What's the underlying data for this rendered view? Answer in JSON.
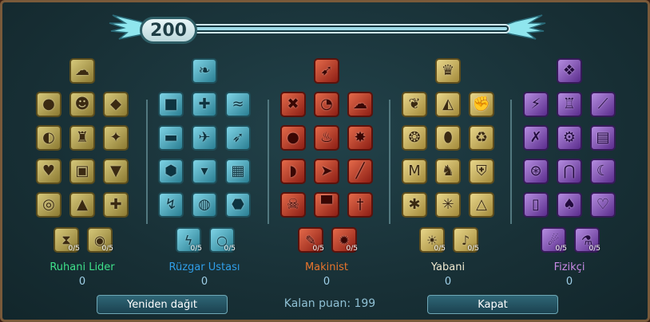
{
  "level": {
    "value": "200",
    "progress": 1.0
  },
  "trees": [
    {
      "name": "Ruhani Lider",
      "points": "0",
      "color": "#3ee08a",
      "theme": "t-green",
      "top_icon": "spirit-icon",
      "grid": [
        "apple-icon",
        "mask-icon",
        "shield-icon",
        "shell-icon",
        "totem-icon",
        "rune-icon",
        "heart-icon",
        "chest-icon",
        "vest-icon",
        "ring-icon",
        "spikes-icon",
        "heart-plus-icon"
      ],
      "perks": [
        {
          "icon": "hourglass-icon",
          "count": "0/5"
        },
        {
          "icon": "orb-icon",
          "count": "0/5"
        }
      ]
    },
    {
      "name": "Rüzgar Ustası",
      "points": "0",
      "color": "#2f9ee8",
      "theme": "t-blue",
      "top_icon": "feather-icon",
      "grid": [
        "box-icon",
        "medic-icon",
        "wave-icon",
        "log-icon",
        "eagle-icon",
        "bow-icon",
        "rock-icon",
        "drop-icon",
        "crate-icon",
        "hook-icon",
        "globe-icon",
        "nut-icon"
      ],
      "perks": [
        {
          "icon": "lightning-icon",
          "count": "0/5"
        },
        {
          "icon": "bubble-icon",
          "count": "0/5"
        }
      ]
    },
    {
      "name": "Makinist",
      "points": "0",
      "color": "#e8742c",
      "theme": "t-red",
      "top_icon": "rocket-icon",
      "grid": [
        "cross-icon",
        "swirl-icon",
        "sheep-icon",
        "bomb-icon",
        "flame-icon",
        "burst-icon",
        "balloon-icon",
        "arrow-icon",
        "rifle-icon",
        "skull-icon",
        "anvil-icon",
        "sword-icon"
      ],
      "perks": [
        {
          "icon": "wrench-icon",
          "count": "0/5"
        },
        {
          "icon": "blast-icon",
          "count": "0/5"
        }
      ]
    },
    {
      "name": "Yabani",
      "points": "0",
      "color": "#f0ead0",
      "theme": "t-yellow",
      "top_icon": "viking-icon",
      "grid": [
        "leaf-icon",
        "fur-icon",
        "fist-icon",
        "paw-icon",
        "egg-icon",
        "recycle-icon",
        "meep-icon",
        "chicken-icon",
        "armor-icon",
        "beetle-icon",
        "web-icon",
        "trap-icon"
      ],
      "perks": [
        {
          "icon": "sun-icon",
          "count": "0/5"
        },
        {
          "icon": "horn-icon",
          "count": "0/5"
        }
      ]
    },
    {
      "name": "Fizikçi",
      "points": "0",
      "color": "#c98ae6",
      "theme": "t-purple",
      "top_icon": "crystal-icon",
      "grid": [
        "bolt-icon",
        "lamp-icon",
        "blade-icon",
        "x-icon",
        "gear-icon",
        "book-icon",
        "saw-icon",
        "magnet-icon",
        "moon-icon",
        "door-icon",
        "bag-icon",
        "broken-heart-icon"
      ],
      "perks": [
        {
          "icon": "meteor-icon",
          "count": "0/5"
        },
        {
          "icon": "potion-icon",
          "count": "0/5"
        }
      ]
    }
  ],
  "buttons": {
    "reset": "Yeniden dağıt",
    "close": "Kapat"
  },
  "remaining_label": "Kalan puan: 199"
}
